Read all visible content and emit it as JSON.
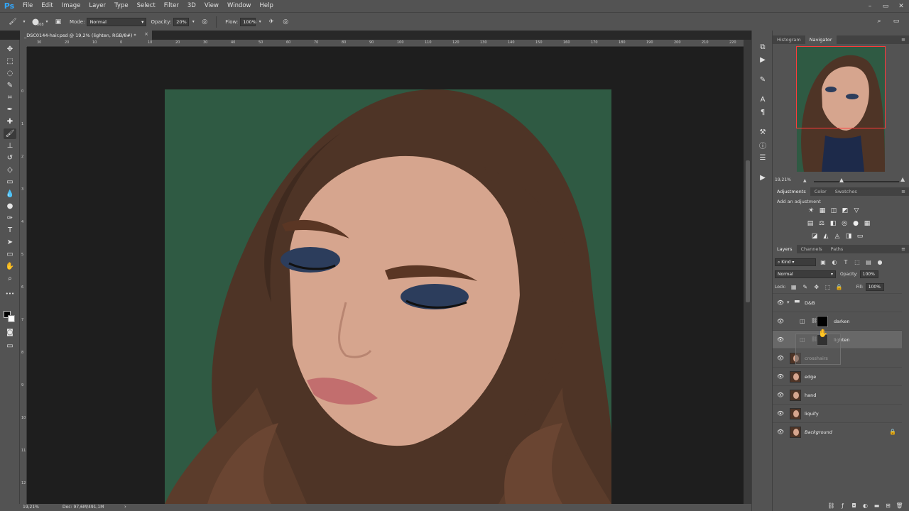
{
  "app": {
    "logo": "Ps"
  },
  "menu": [
    "File",
    "Edit",
    "Image",
    "Layer",
    "Type",
    "Select",
    "Filter",
    "3D",
    "View",
    "Window",
    "Help"
  ],
  "window_controls": [
    "–",
    "▭",
    "✕"
  ],
  "options": {
    "brush_size": "868",
    "mode_label": "Mode:",
    "mode_value": "Normal",
    "opacity_label": "Opacity:",
    "opacity_value": "20%",
    "flow_label": "Flow:",
    "flow_value": "100%"
  },
  "document_tab": {
    "title": "_DSC0144-hair.psd @ 19,2% (lighten, RGB/8#) *",
    "close": "×"
  },
  "ruler_top_ticks": [
    "30",
    "20",
    "10",
    "0",
    "10",
    "20",
    "30",
    "40",
    "50",
    "60",
    "70",
    "80",
    "90",
    "100",
    "110",
    "120",
    "130",
    "140",
    "150",
    "160",
    "170",
    "180",
    "190",
    "200",
    "210",
    "220"
  ],
  "ruler_left_ticks": [
    "0",
    "1",
    "2",
    "3",
    "4",
    "5",
    "6",
    "7",
    "8",
    "9",
    "10",
    "11",
    "12",
    "13"
  ],
  "status": {
    "zoom": "19,21%",
    "doc": "Doc: 97,6M/491,1M",
    "arrow": "›"
  },
  "navigator": {
    "tabs": [
      "Histogram",
      "Navigator"
    ],
    "active_tab": "Navigator",
    "zoom": "19,21%"
  },
  "adjustments": {
    "tabs": [
      "Adjustments",
      "Color",
      "Swatches"
    ],
    "active_tab": "Adjustments",
    "title": "Add an adjustment",
    "row1": [
      "☀",
      "▦",
      "◫",
      "◩",
      "▽"
    ],
    "row2": [
      "▤",
      "⚖",
      "◧",
      "◎",
      "●",
      "▦"
    ],
    "row3": [
      "◪",
      "◭",
      "◬",
      "◨",
      "▭"
    ]
  },
  "layers": {
    "tabs": [
      "Layers",
      "Channels",
      "Paths"
    ],
    "active_tab": "Layers",
    "filter_kind": "Kind",
    "blend_mode": "Normal",
    "opacity_label": "Opacity:",
    "opacity_value": "100%",
    "lock_label": "Lock:",
    "fill_label": "Fill:",
    "fill_value": "100%",
    "items": [
      {
        "name": "D&B",
        "type": "group"
      },
      {
        "name": "darken",
        "type": "adjustment"
      },
      {
        "name": "lighten",
        "type": "adjustment",
        "selected": true
      },
      {
        "name": "crosshairs",
        "type": "pixel"
      },
      {
        "name": "edge",
        "type": "pixel"
      },
      {
        "name": "hand",
        "type": "pixel"
      },
      {
        "name": "liquify",
        "type": "pixel"
      },
      {
        "name": "Background",
        "type": "background",
        "locked": true
      }
    ]
  },
  "colors": {
    "background_green": "#2f5a43",
    "hair_brown": "#5a3d2e",
    "skin": "#d6a58e",
    "nav_box": "#ff3b3b",
    "ps_blue": "#31a8ff"
  }
}
